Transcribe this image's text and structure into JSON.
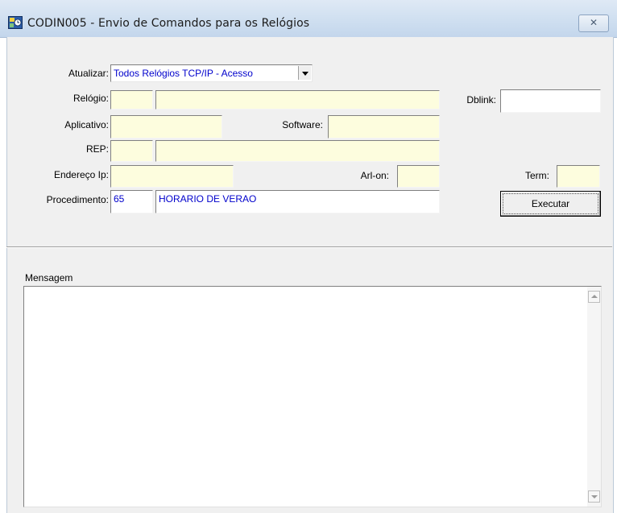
{
  "window": {
    "title": "CODIN005 - Envio de Comandos para os Relógios",
    "close_glyph": "✕"
  },
  "form": {
    "atualizar_label": "Atualizar:",
    "atualizar_value": "Todos Relógios TCP/IP - Acesso",
    "relogio_label": "Relógio:",
    "relogio_code": "",
    "relogio_name": "",
    "dblink_label": "Dblink:",
    "dblink_value": "",
    "aplicativo_label": "Aplicativo:",
    "aplicativo_value": "",
    "software_label": "Software:",
    "software_value": "",
    "rep_label": "REP:",
    "rep_code": "",
    "rep_name": "",
    "endereco_label": "Endereço Ip:",
    "endereco_value": "",
    "arlon_label": "Arl-on:",
    "arlon_value": "",
    "term_label": "Term:",
    "term_value": "",
    "procedimento_label": "Procedimento:",
    "procedimento_code": "65",
    "procedimento_name": "HORARIO DE VERAO",
    "executar_label": "Executar"
  },
  "mensagem": {
    "label": "Mensagem",
    "text": ""
  },
  "icons": {
    "app": "app-icon",
    "scroll_up": "scroll-up-icon",
    "scroll_down": "scroll-down-icon"
  }
}
